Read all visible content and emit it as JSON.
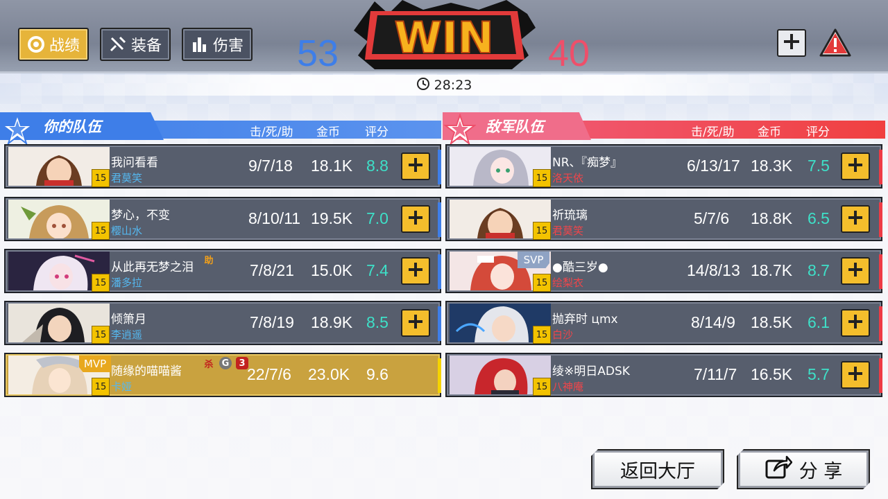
{
  "tabs": [
    {
      "label": "战绩",
      "icon": "ring-icon",
      "active": true
    },
    {
      "label": "装备",
      "icon": "sword-icon",
      "active": false
    },
    {
      "label": "伤害",
      "icon": "bar-chart-icon",
      "active": false
    }
  ],
  "score": {
    "blue": "53",
    "red": "40",
    "result": "WIN"
  },
  "timer": "28:23",
  "headers": {
    "ally_title": "你的队伍",
    "enemy_title": "敌军队伍",
    "kda": "击/死/助",
    "gold": "金币",
    "rating": "评分"
  },
  "ally": [
    {
      "name": "我问看看",
      "hero": "君莫笑",
      "level": "15",
      "kda": "9/7/18",
      "gold": "18.1K",
      "rating": "8.8"
    },
    {
      "name": "梦心，不变",
      "hero": "樱山水",
      "level": "15",
      "kda": "8/10/11",
      "gold": "19.5K",
      "rating": "7.0"
    },
    {
      "name": "从此再无梦之泪",
      "hero": "潘多拉",
      "level": "15",
      "kda": "7/8/21",
      "gold": "15.0K",
      "rating": "7.4",
      "tag": "助"
    },
    {
      "name": "倾箫月",
      "hero": "李逍遥",
      "level": "15",
      "kda": "7/8/19",
      "gold": "18.9K",
      "rating": "8.5"
    },
    {
      "name": "随缘的喵喵酱",
      "hero": "卡娅",
      "level": "15",
      "kda": "22/7/6",
      "gold": "23.0K",
      "rating": "9.6",
      "badge": "MVP",
      "tags": [
        "杀",
        "G",
        "3"
      ]
    }
  ],
  "enemy": [
    {
      "name": "NR、『痴梦』",
      "hero": "洛天依",
      "level": "15",
      "kda": "6/13/17",
      "gold": "18.3K",
      "rating": "7.5"
    },
    {
      "name": "祈琉璃",
      "hero": "君莫笑",
      "level": "15",
      "kda": "5/7/6",
      "gold": "18.8K",
      "rating": "6.5"
    },
    {
      "name": "●酷三岁●",
      "hero": "绘梨衣",
      "level": "15",
      "kda": "14/8/13",
      "gold": "18.7K",
      "rating": "8.7",
      "badge": "SVP"
    },
    {
      "name": "抛弃时 цmx",
      "hero": "白沙",
      "level": "15",
      "kda": "8/14/9",
      "gold": "18.5K",
      "rating": "6.1"
    },
    {
      "name": "绫※明日ADSK",
      "hero": "八神庵",
      "level": "15",
      "kda": "7/11/7",
      "gold": "16.5K",
      "rating": "5.7"
    }
  ],
  "buttons": {
    "lobby": "返回大厅",
    "share": "分 享"
  },
  "colors": {
    "ally": "#3e7ee8",
    "enemy": "#ee4f6a",
    "gold": "#e6b43a",
    "rating": "#3ee0c8"
  }
}
